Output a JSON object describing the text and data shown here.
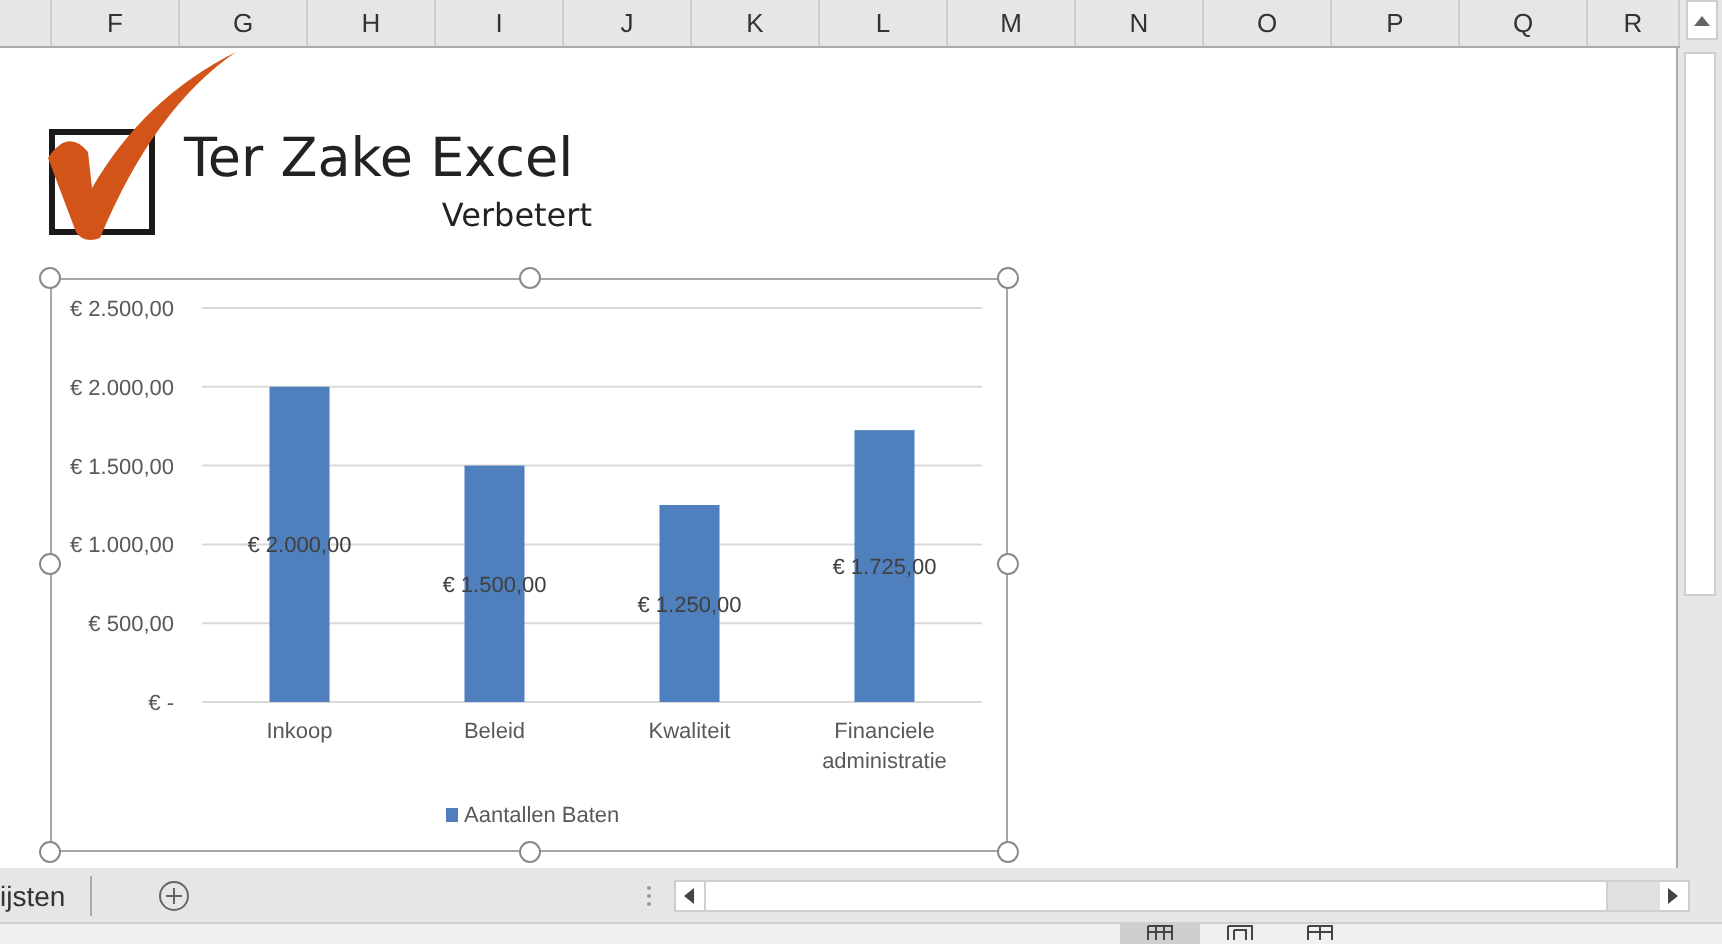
{
  "columns": [
    "",
    "F",
    "G",
    "H",
    "I",
    "J",
    "K",
    "L",
    "M",
    "N",
    "O",
    "P",
    "Q",
    "R"
  ],
  "logo": {
    "title": "Ter Zake Excel",
    "tagline": "Verbetert"
  },
  "chart": {
    "chart_data": {
      "type": "bar",
      "grid": true,
      "categories": [
        "Inkoop",
        "Beleid",
        "Kwaliteit",
        "Financiele administratie"
      ],
      "series": [
        {
          "name": "Aantallen Baten",
          "color": "#4f7fbc",
          "values": [
            2000,
            1500,
            1250,
            1725
          ]
        }
      ],
      "ylim": [
        0,
        2500
      ],
      "yticks": [
        {
          "value": 0,
          "label": "€ -"
        },
        {
          "value": 500,
          "label": "€ 500,00"
        },
        {
          "value": 1000,
          "label": "€ 1.000,00"
        },
        {
          "value": 1500,
          "label": "€ 1.500,00"
        },
        {
          "value": 2000,
          "label": "€ 2.000,00"
        },
        {
          "value": 2500,
          "label": "€ 2.500,00"
        }
      ],
      "value_labels": [
        "€ 2.000,00",
        "€ 1.500,00",
        "€ 1.250,00",
        "€ 1.725,00"
      ]
    }
  },
  "sheet_tabs": [
    {
      "label": "ijsten",
      "selected": false
    }
  ],
  "views": [
    {
      "kind": "normal",
      "selected": true
    },
    {
      "kind": "page-layout",
      "selected": false
    },
    {
      "kind": "page-break",
      "selected": false
    }
  ]
}
